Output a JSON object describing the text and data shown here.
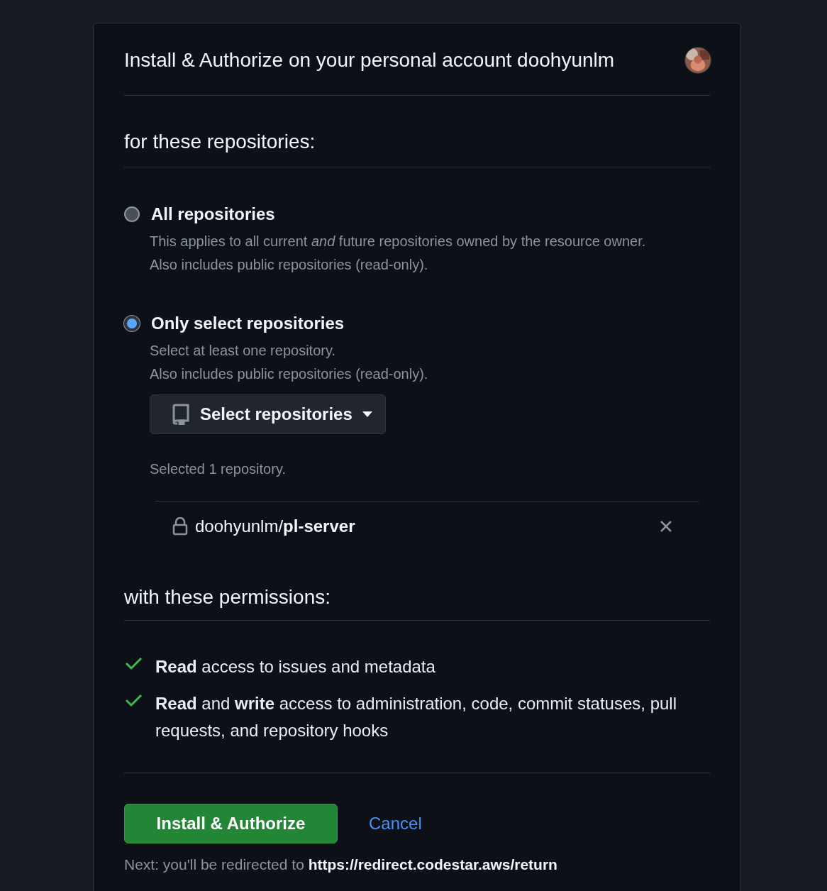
{
  "header": {
    "title": "Install & Authorize on your personal account doohyunlm"
  },
  "repositories": {
    "heading": "for these repositories:",
    "options": [
      {
        "label": "All repositories",
        "selected": false,
        "description": [
          "This applies to all current *and* future repositories owned by the resource owner.",
          "Also includes public repositories (read-only)."
        ]
      },
      {
        "label": "Only select repositories",
        "selected": true,
        "description": [
          "Select at least one repository.",
          "Also includes public repositories (read-only)."
        ]
      }
    ],
    "select_button": "Select repositories",
    "selected_count": "Selected 1 repository.",
    "selected_repos": [
      "doohyunlm/**pl-server**"
    ]
  },
  "permissions": {
    "heading": "with these permissions:",
    "items": [
      "**Read** access to issues and metadata",
      "**Read** and **write** access to administration, code, commit statuses, pull requests, and repository hooks"
    ]
  },
  "actions": {
    "primary": "Install & Authorize",
    "cancel": "Cancel",
    "next_prefix": "Next: you'll be redirected to",
    "next_url": "https://redirect.codestar.aws/return"
  }
}
